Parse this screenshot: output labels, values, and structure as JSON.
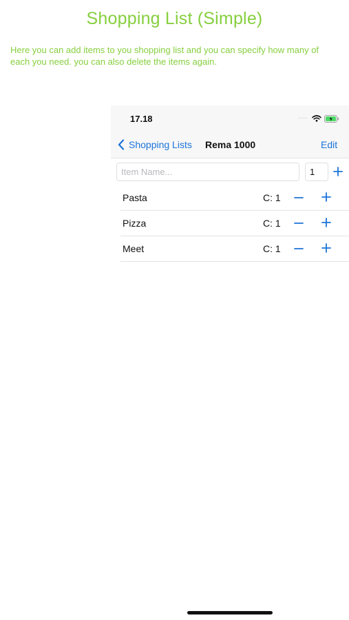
{
  "page": {
    "title": "Shopping List (Simple)",
    "description": "Here you can add items to you shopping list and you can specify how many of each you need. you can also delete the items again.",
    "accent_color": "#86cf3e"
  },
  "status_bar": {
    "time": "17.18",
    "signal": "....",
    "icons": [
      "wifi-icon",
      "battery-charging-icon"
    ]
  },
  "nav_bar": {
    "back_label": "Shopping Lists",
    "title": "Rema 1000",
    "edit_label": "Edit",
    "tint_color": "#1a73d9"
  },
  "add_form": {
    "name_placeholder": "Item Name...",
    "name_value": "",
    "quantity_value": "1",
    "add_icon": "plus-icon"
  },
  "items": [
    {
      "name": "Pasta",
      "count": "C: 1"
    },
    {
      "name": "Pizza",
      "count": "C: 1"
    },
    {
      "name": "Meet",
      "count": "C: 1"
    }
  ]
}
